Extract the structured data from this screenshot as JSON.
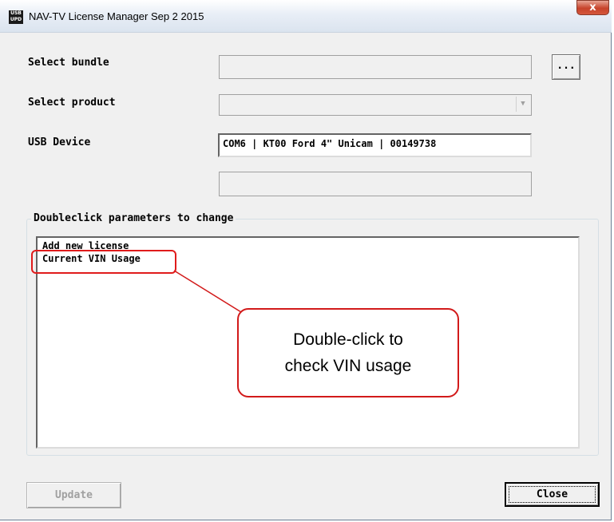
{
  "window": {
    "title": "NAV-TV License Manager  Sep  2 2015",
    "icon_top": "USB",
    "icon_bottom": "UPD",
    "close_glyph": "x"
  },
  "form": {
    "bundle_label": "Select bundle",
    "bundle_value": "",
    "browse_label": "...",
    "product_label": "Select product",
    "product_value": "",
    "usb_label": "USB Device",
    "usb_value": "COM6 | KT00 Ford 4\" Unicam | 00149738",
    "extra_value": ""
  },
  "group": {
    "title": "Doubleclick parameters to change",
    "items": [
      "Add new license",
      "Current VIN Usage"
    ]
  },
  "annotation": {
    "line1": "Double-click to",
    "line2": "check VIN usage",
    "color": "#d21a1a"
  },
  "buttons": {
    "update": "Update",
    "close": "Close"
  }
}
